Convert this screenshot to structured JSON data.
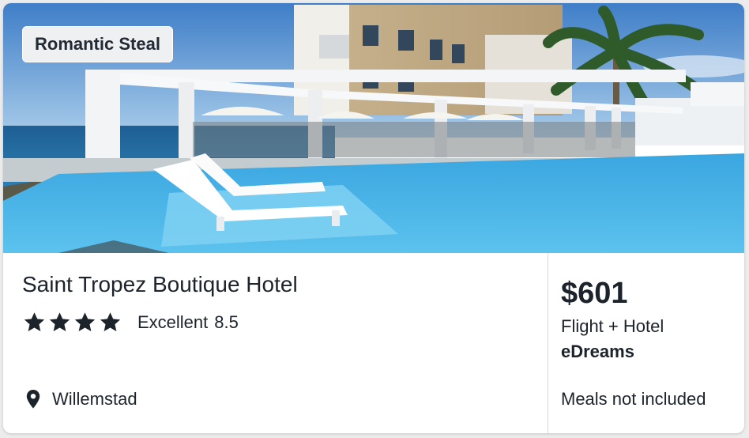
{
  "badge": {
    "label": "Romantic Steal"
  },
  "hotel": {
    "name": "Saint Tropez Boutique Hotel",
    "star_count": 4,
    "rating_label": "Excellent",
    "rating_score": "8.5",
    "location": "Willemstad"
  },
  "offer": {
    "price": "$601",
    "package": "Flight + Hotel",
    "provider": "eDreams",
    "meals": "Meals not included"
  },
  "icons": {
    "star": "star-icon",
    "location": "location-pin-icon"
  },
  "colors": {
    "text": "#1c232b",
    "badge_bg": "#eef0f2",
    "divider": "#d7d9dc"
  }
}
